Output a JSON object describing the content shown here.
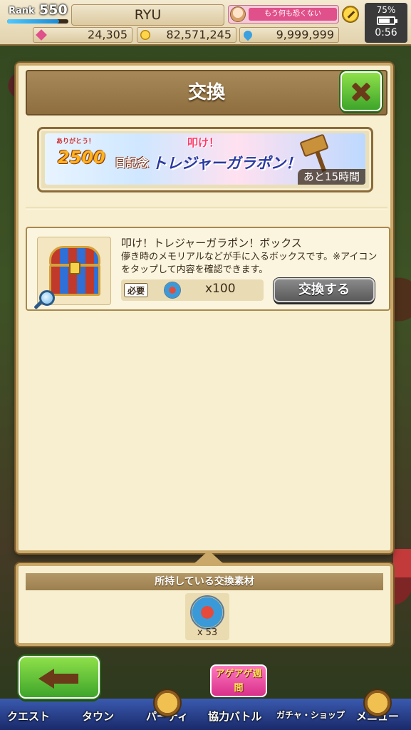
{
  "status_bar": {
    "rank_label": "Rank",
    "rank_value": "550",
    "rank_progress": 0.85,
    "player_name": "RYU",
    "message": "もう何も恐くない",
    "gems": "24,305",
    "coins": "82,571,245",
    "stamina": "9,999,999",
    "battery_percent": "75%",
    "battery_level": 0.75,
    "clock": "0:56"
  },
  "dialog": {
    "title": "交換",
    "banner": {
      "subtitle": "ありがとう！",
      "anniversary": "2500",
      "kinen": "日記念",
      "tataki": "叩け！",
      "main": "トレジャーガラポン！",
      "timer": "あと15時間"
    },
    "item": {
      "name": "叩け！トレジャーガラポン！ボックス",
      "description": "儚き時のメモリアルなどが手に入るボックスです。※アイコンをタップして内容を確認できます。",
      "cost_label": "必要",
      "cost_amount": "x100",
      "exchange_label": "交換する"
    }
  },
  "materials": {
    "header": "所持している交換素材",
    "count": "x 53"
  },
  "nav": {
    "badge": "アゲアゲ週間",
    "items": [
      "クエスト",
      "タウン",
      "パーティ",
      "協力バトル",
      "ガチャ・ショップ",
      "メニュー"
    ]
  },
  "colors": {
    "accent_green": "#3ea52a",
    "frame_brown": "#8d6d3e",
    "panel_cream": "#f7efd0"
  }
}
